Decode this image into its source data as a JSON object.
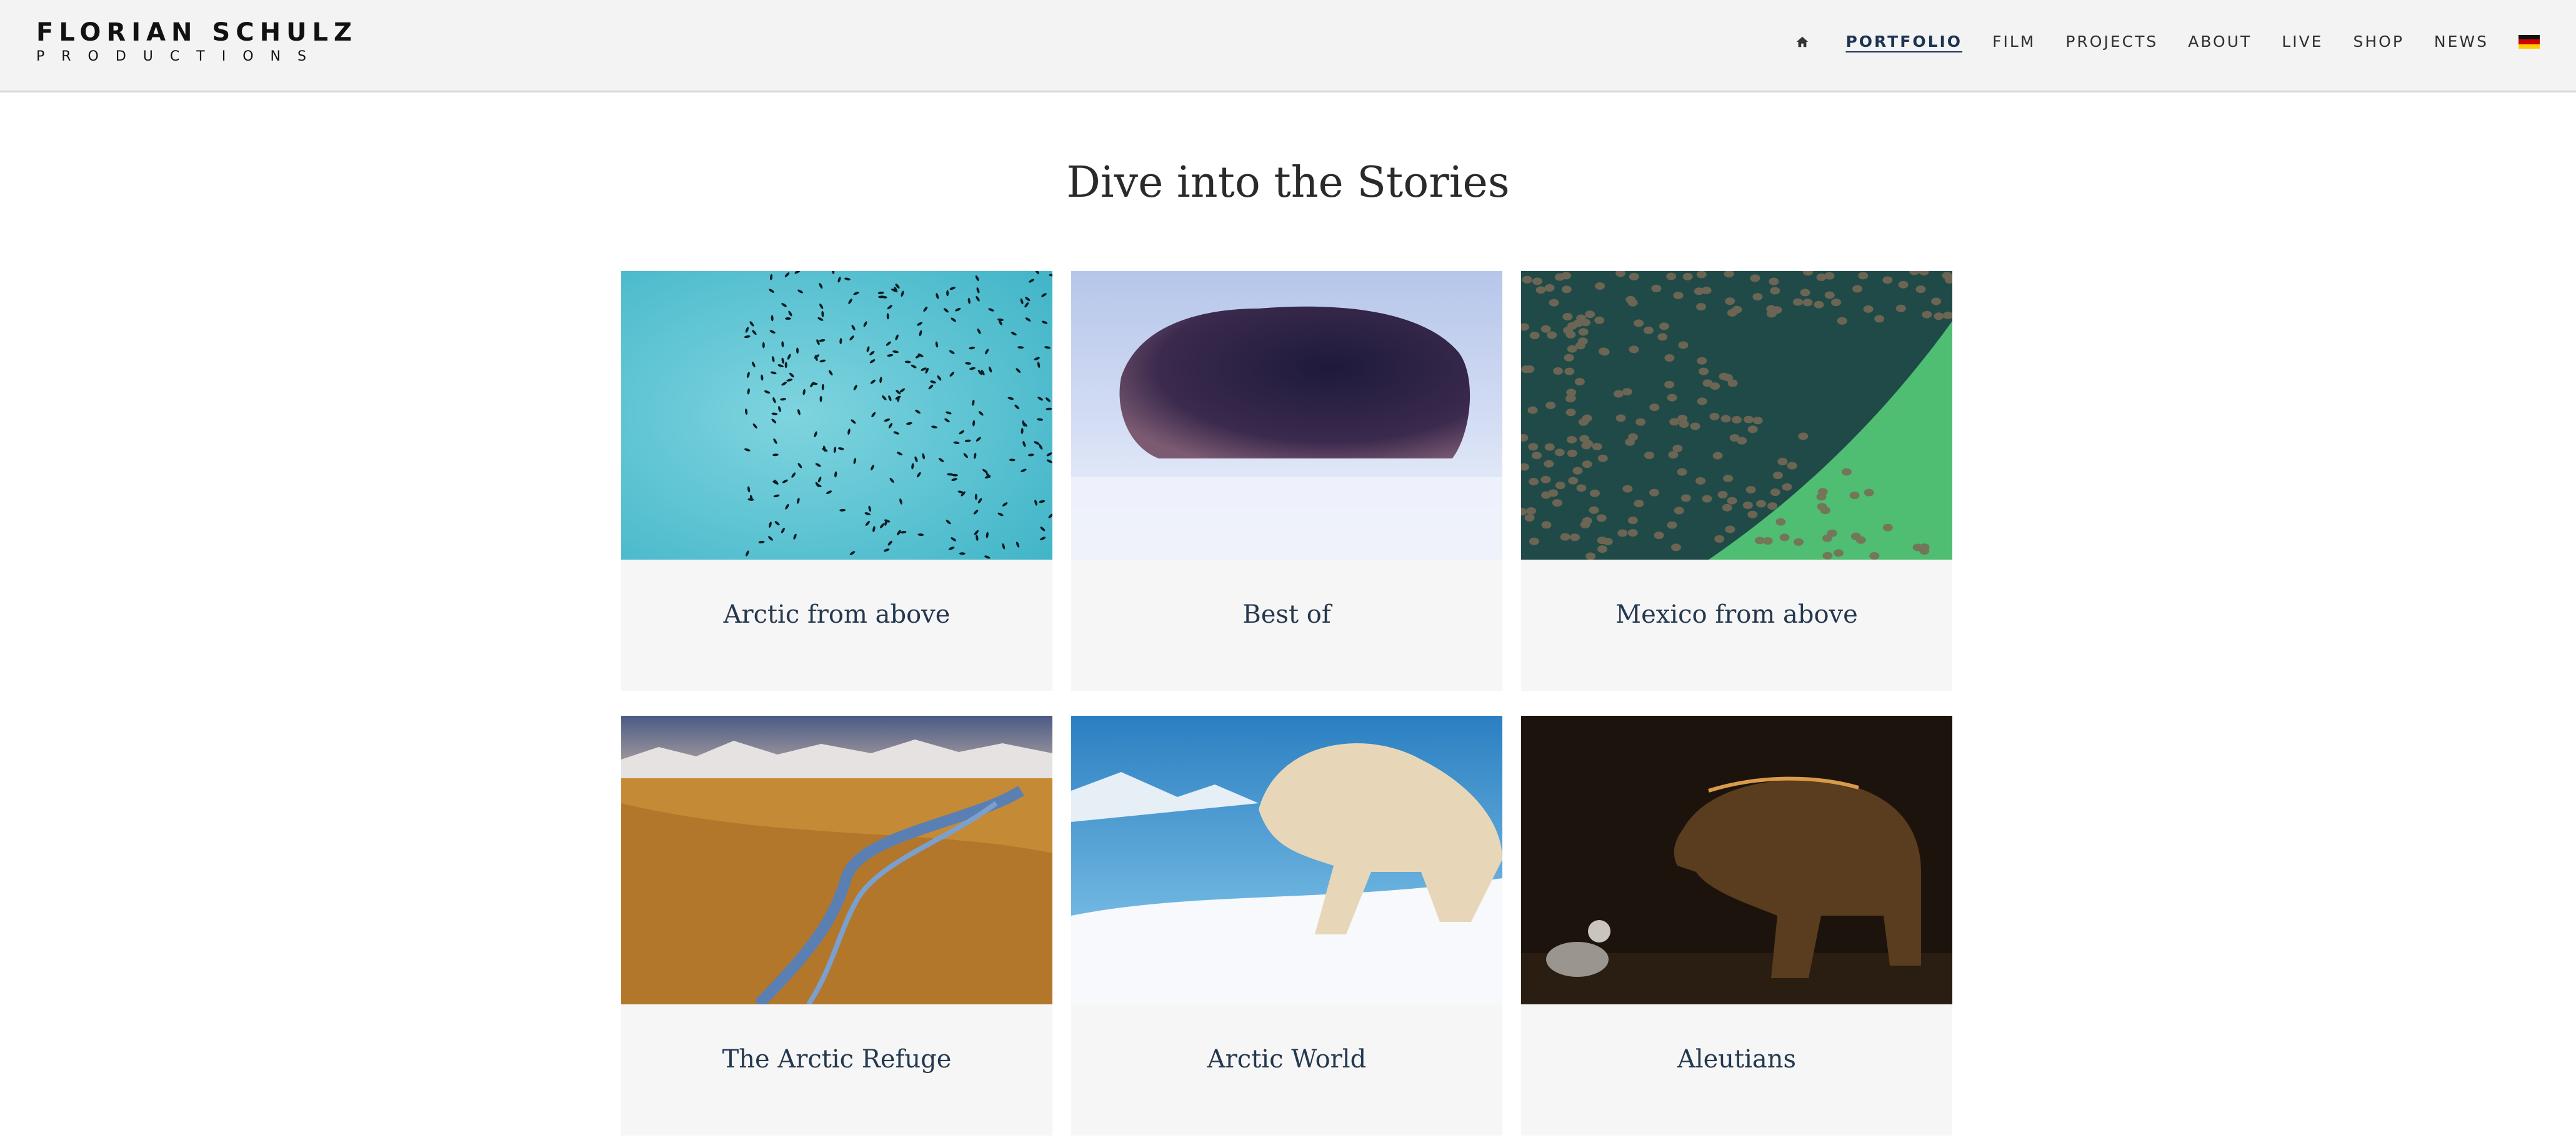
{
  "header": {
    "logo_line1": "FLORIAN SCHULZ",
    "logo_line2": "PRODUCTIONS",
    "nav": [
      "PORTFOLIO",
      "FILM",
      "PROJECTS",
      "ABOUT",
      "LIVE",
      "SHOP",
      "NEWS"
    ],
    "active_nav": "PORTFOLIO",
    "home_icon": "home-icon",
    "language_icon": "german-flag-icon"
  },
  "main": {
    "title": "Dive into the Stories",
    "stories": [
      {
        "title": "Arctic from above",
        "image": "seabirds flock over turquoise water"
      },
      {
        "title": "Best of",
        "image": "musk ox in blizzard"
      },
      {
        "title": "Mexico from above",
        "image": "school of rays near green shallows"
      },
      {
        "title": "The Arctic Refuge",
        "image": "braided river across tundra with mountains"
      },
      {
        "title": "Arctic World",
        "image": "polar bear on snow by icy water"
      },
      {
        "title": "Aleutians",
        "image": "brown bear and gull in dark light"
      }
    ]
  },
  "colors": {
    "header_bg": "#f3f3f3",
    "active_nav": "#1c3352",
    "caption": "#24384f",
    "card_bg": "#f6f6f6"
  }
}
